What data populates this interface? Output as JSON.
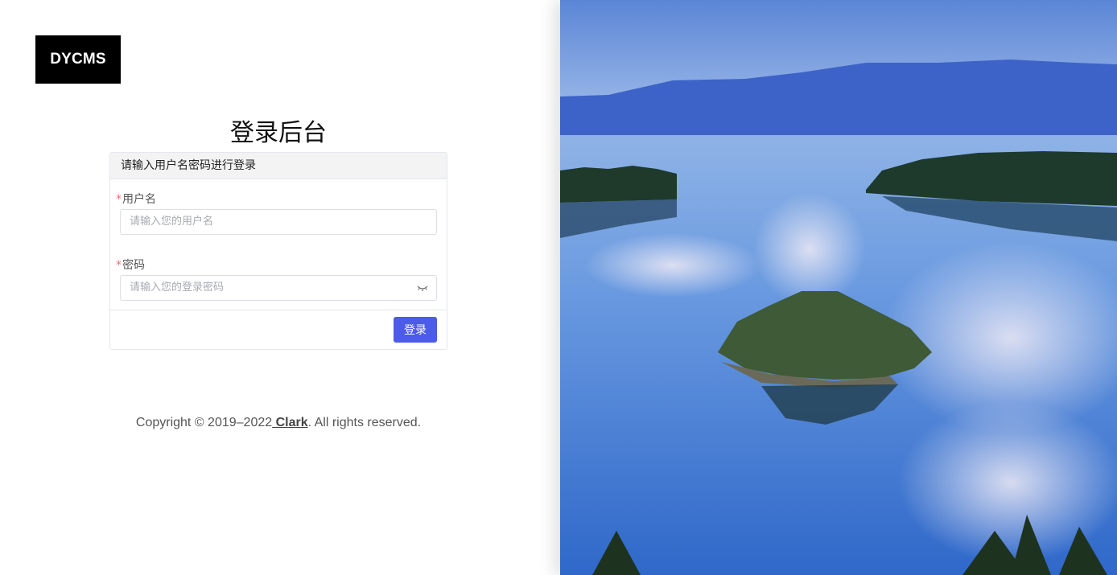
{
  "brand": {
    "logo_text": "DYCMS"
  },
  "login": {
    "title": "登录后台",
    "card_header": "请输入用户名密码进行登录",
    "username": {
      "required_mark": "*",
      "label": "用户名",
      "placeholder": "请输入您的用户名"
    },
    "password": {
      "required_mark": "*",
      "label": "密码",
      "placeholder": "请输入您的登录密码",
      "toggle_icon": "eye-closed-icon"
    },
    "submit_label": "登录"
  },
  "footer": {
    "prefix": "Copyright © 2019–2022",
    "author": " Clark",
    "suffix": ". All rights reserved."
  },
  "colors": {
    "primary": "#4c5bea",
    "required": "#f56c6c",
    "logo_bg": "#000000"
  }
}
